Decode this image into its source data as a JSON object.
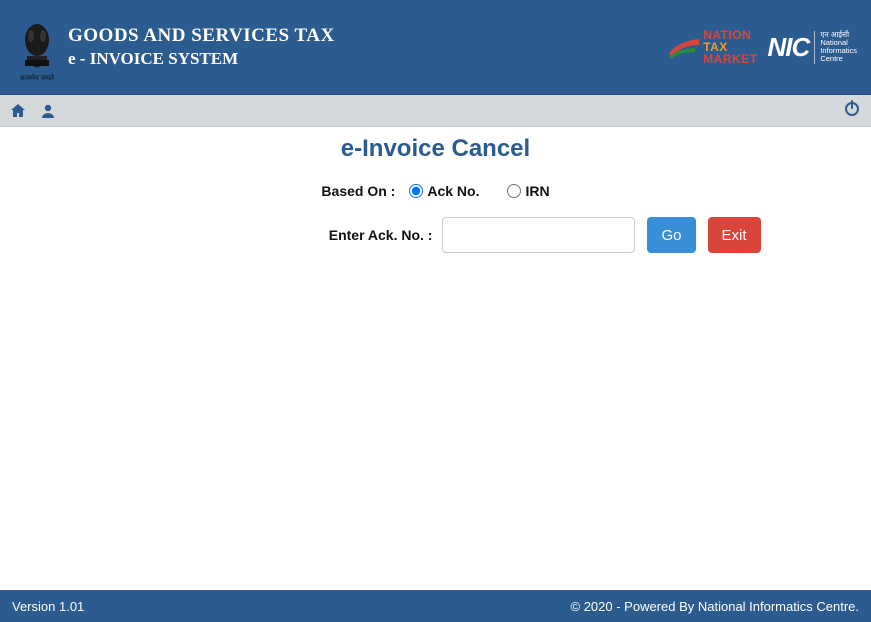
{
  "header": {
    "title1": "GOODS AND SERVICES TAX",
    "title2": "e - INVOICE SYSTEM",
    "emblem_caption": "सत्यमेव जयते",
    "ntm": {
      "l1": "NATION",
      "l2": "TAX",
      "l3": "MARKET"
    },
    "nic": {
      "big": "NIC",
      "l1": "एन आईसी",
      "l2": "National",
      "l3": "Informatics",
      "l4": "Centre"
    }
  },
  "page": {
    "title": "e-Invoice Cancel",
    "based_on_label": "Based On :",
    "radio_ack": "Ack No.",
    "radio_irn": "IRN",
    "ack_label": "Enter Ack. No. :",
    "ack_value": "",
    "go": "Go",
    "exit": "Exit"
  },
  "footer": {
    "version": "Version 1.01",
    "copyright": "© 2020 - Powered By National Informatics Centre."
  },
  "form_state": {
    "based_on": "ack"
  }
}
